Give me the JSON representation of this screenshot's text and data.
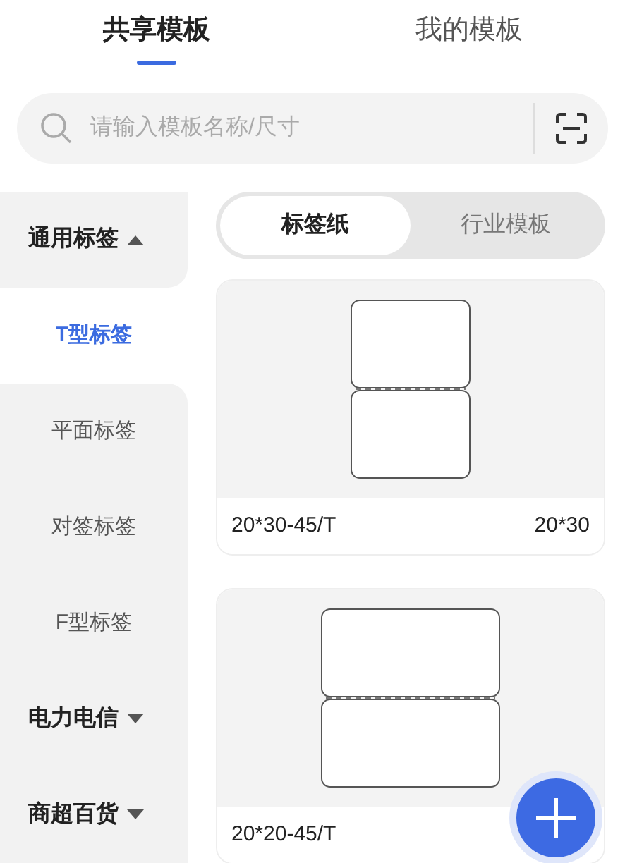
{
  "tabs": [
    {
      "label": "共享模板",
      "selected": true
    },
    {
      "label": "我的模板",
      "selected": false
    }
  ],
  "search": {
    "placeholder": "请输入模板名称/尺寸"
  },
  "sidebar": {
    "categories": [
      {
        "label": "通用标签",
        "expanded": true,
        "children": [
          {
            "label": "T型标签",
            "selected": true
          },
          {
            "label": "平面标签",
            "selected": false
          },
          {
            "label": "对签标签",
            "selected": false
          },
          {
            "label": "F型标签",
            "selected": false
          }
        ]
      },
      {
        "label": "电力电信",
        "expanded": false
      },
      {
        "label": "商超百货",
        "expanded": false
      }
    ]
  },
  "segments": [
    {
      "label": "标签纸",
      "selected": true
    },
    {
      "label": "行业模板",
      "selected": false
    }
  ],
  "templates": [
    {
      "kind": "portrait",
      "name": "20*30-45/T",
      "size": "20*30"
    },
    {
      "kind": "landscape",
      "name": "20*20-45/T"
    }
  ]
}
